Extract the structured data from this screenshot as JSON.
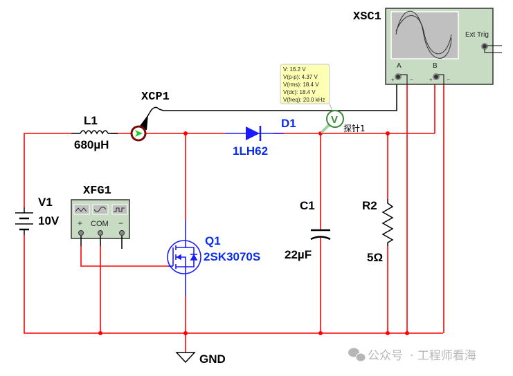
{
  "colors": {
    "wire": "#ff0000",
    "component_blue": "#1a1aff",
    "probe_ring": "#7a0a0a",
    "instrument_bg": "#c8dcc4",
    "tooltip_bg": "#ffffb4"
  },
  "components": {
    "inductor": {
      "ref": "L1",
      "value": "680µH"
    },
    "current_probe": {
      "ref": "XCP1"
    },
    "diode": {
      "ref": "D1",
      "value": "1LH62"
    },
    "voltage_probe": {
      "icon": "V",
      "name": "探针1",
      "readings": [
        "V: 16.2 V",
        "V(p-p): 4.37 V",
        "V(rms): 18.4 V",
        "V(dc): 18.4 V",
        "V(freq): 20.0 kHz"
      ]
    },
    "oscilloscope": {
      "ref": "XSC1",
      "ext_trig": "Ext Trig",
      "channel_a": "A",
      "channel_b": "B",
      "plus": "+",
      "minus": "−"
    },
    "battery": {
      "ref": "V1",
      "value": "10V"
    },
    "function_generator": {
      "ref": "XFG1",
      "plus": "+",
      "com": "COM",
      "minus": "−",
      "waveforms": [
        "triangle",
        "sine",
        "square"
      ]
    },
    "mosfet": {
      "ref": "Q1",
      "value": "2SK3070S"
    },
    "capacitor": {
      "ref": "C1",
      "value": "22µF"
    },
    "resistor": {
      "ref": "R2",
      "value": "5Ω"
    },
    "ground": {
      "label": "GND"
    }
  },
  "watermark": {
    "text1": "公众号",
    "text2": "· 工程师看海"
  }
}
